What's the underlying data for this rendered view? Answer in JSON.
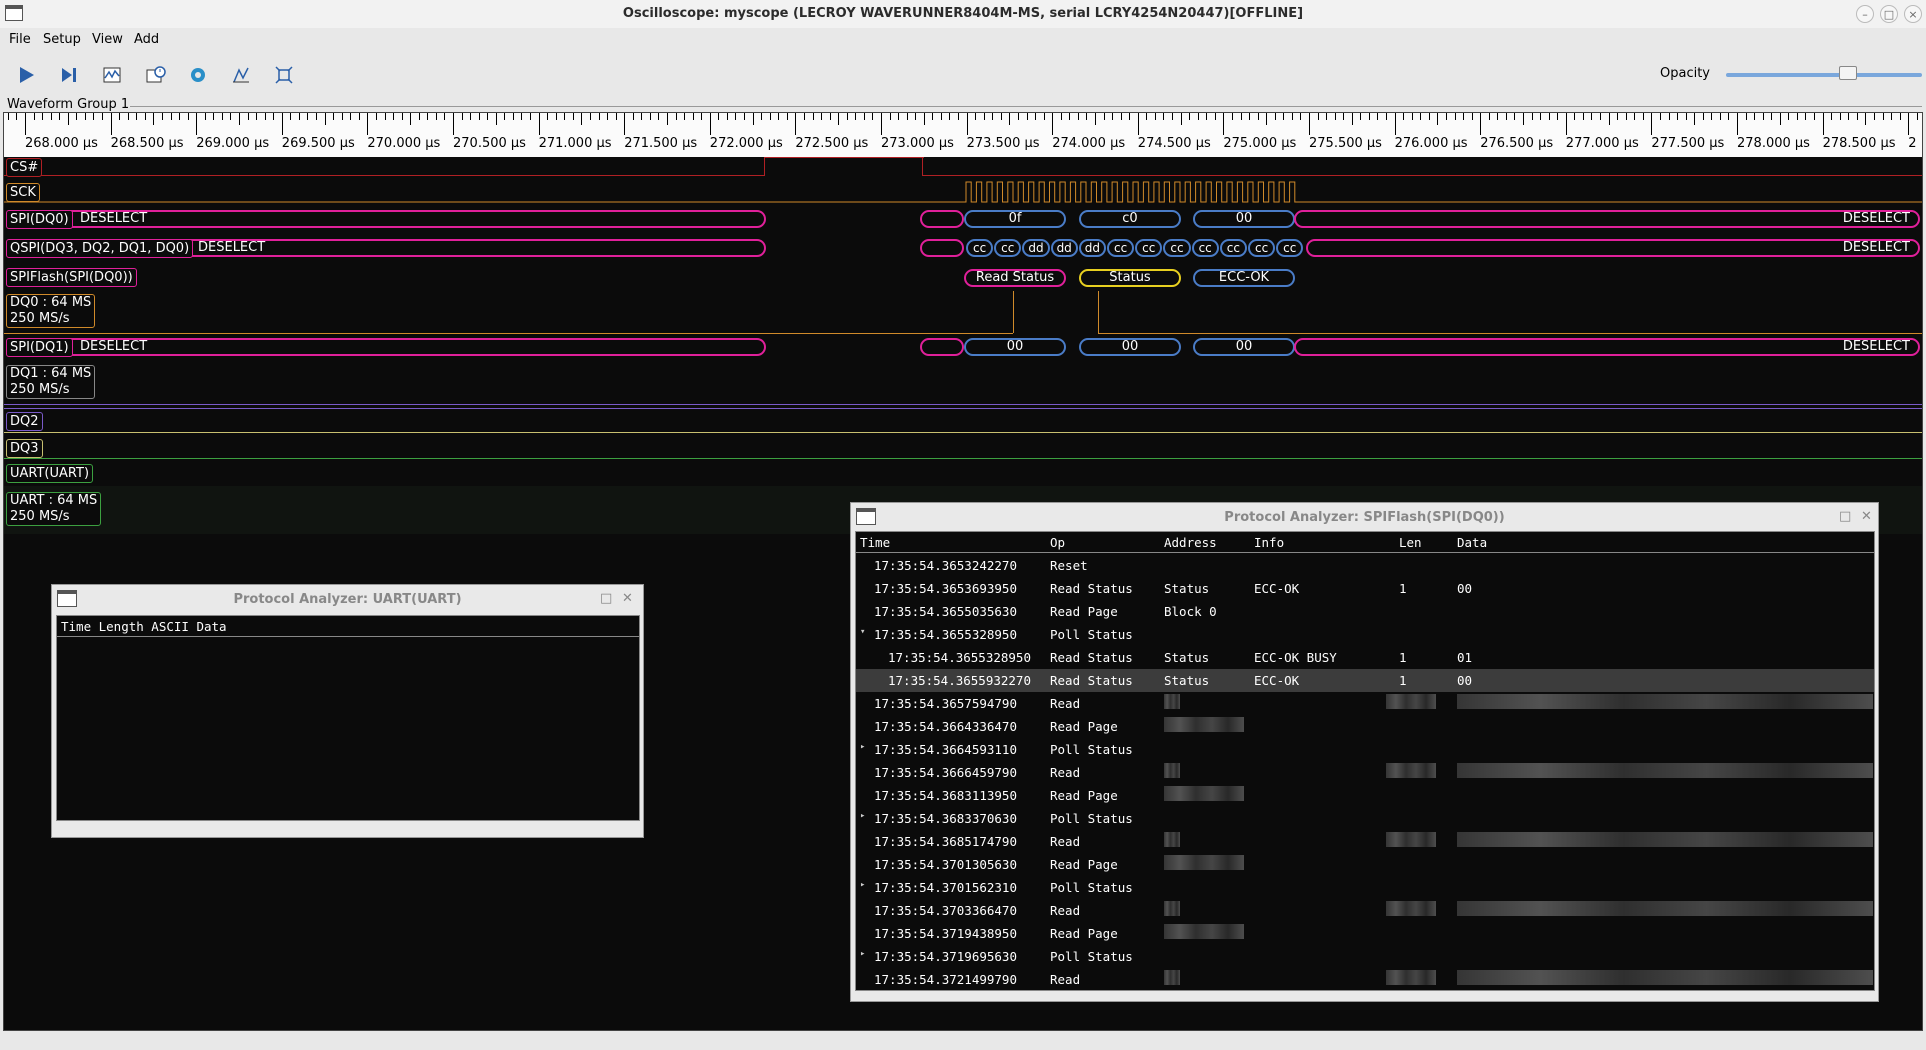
{
  "window": {
    "title": "Oscilloscope: myscope (LECROY WAVERUNNER8404M-MS, serial LCRY4254N20447)[OFFLINE]"
  },
  "menu": [
    "File",
    "Setup",
    "View",
    "Add"
  ],
  "toolbar": {
    "icons": [
      "start-icon",
      "single-trigger-icon",
      "waveform-icon",
      "history-icon",
      "gear-icon",
      "measure-icon",
      "fullscreen-icon"
    ],
    "opacity_label": "Opacity",
    "opacity_value": 0.62
  },
  "group": {
    "label": "Waveform Group 1"
  },
  "ruler": {
    "labels": [
      "268.000 µs",
      "268.500 µs",
      "269.000 µs",
      "269.500 µs",
      "270.000 µs",
      "270.500 µs",
      "271.000 µs",
      "271.500 µs",
      "272.000 µs",
      "272.500 µs",
      "273.000 µs",
      "273.500 µs",
      "274.000 µs",
      "274.500 µs",
      "275.000 µs",
      "275.500 µs",
      "276.000 µs",
      "276.500 µs",
      "277.000 µs",
      "277.500 µs",
      "278.000 µs",
      "278.500 µs",
      "2"
    ]
  },
  "traces": {
    "cs": "CS#",
    "sck": "SCK",
    "spi_dq0": {
      "name": "SPI(DQ0)",
      "left": "DESELECT",
      "right": "DESELECT",
      "bytes": [
        "0f",
        "c0",
        "00"
      ]
    },
    "qspi": {
      "name": "QSPI(DQ3, DQ2, DQ1, DQ0)",
      "left": "DESELECT",
      "right": "DESELECT",
      "nibbles": [
        "cc",
        "cc",
        "dd",
        "dd",
        "dd",
        "cc",
        "cc",
        "cc",
        "cc",
        "cc",
        "cc",
        "cc"
      ]
    },
    "spiflash": {
      "name": "SPIFlash(SPI(DQ0))",
      "ops": [
        "Read Status",
        "Status",
        "ECC-OK"
      ]
    },
    "dq0": {
      "name": "DQ0 : 64 MS",
      "rate": "250 MS/s"
    },
    "spi_dq1": {
      "name": "SPI(DQ1)",
      "left": "DESELECT",
      "right": "DESELECT",
      "bytes": [
        "00",
        "00",
        "00"
      ]
    },
    "dq1": {
      "name": "DQ1 : 64 MS",
      "rate": "250 MS/s"
    },
    "dq2": "DQ2",
    "dq3": "DQ3",
    "uart_dec": "UART(UART)",
    "uart": {
      "name": "UART : 64 MS",
      "rate": "250 MS/s"
    }
  },
  "uart_panel": {
    "title": "Protocol Analyzer: UART(UART)",
    "header": "Time Length ASCII Data"
  },
  "spi_panel": {
    "title": "Protocol Analyzer: SPIFlash(SPI(DQ0))",
    "columns": [
      "Time",
      "Op",
      "Address",
      "Info",
      "Len",
      "Data"
    ],
    "rows": [
      {
        "arrow": "",
        "time": "17:35:54.3653242270",
        "op": "Reset",
        "addr": "",
        "info": "",
        "len": "",
        "data": ""
      },
      {
        "arrow": "",
        "time": "17:35:54.3653693950",
        "op": "Read Status",
        "addr": "Status",
        "info": "ECC-OK",
        "len": "1",
        "data": "00"
      },
      {
        "arrow": "",
        "time": "17:35:54.3655035630",
        "op": "Read Page",
        "addr": "Block 0",
        "info": "",
        "len": "",
        "data": ""
      },
      {
        "arrow": "▾",
        "time": "17:35:54.3655328950",
        "op": "Poll Status",
        "addr": "",
        "info": "",
        "len": "",
        "data": ""
      },
      {
        "arrow": "",
        "indent": true,
        "time": "17:35:54.3655328950",
        "op": "Read Status",
        "addr": "Status",
        "info": "ECC-OK BUSY",
        "len": "1",
        "data": "01"
      },
      {
        "arrow": "",
        "indent": true,
        "sel": true,
        "time": "17:35:54.3655932270",
        "op": "Read Status",
        "addr": "Status",
        "info": "ECC-OK",
        "len": "1",
        "data": "00"
      },
      {
        "arrow": "",
        "time": "17:35:54.3657594790",
        "op": "Read",
        "addr": "",
        "info": "",
        "len": "",
        "data": "",
        "blurred": true
      },
      {
        "arrow": "",
        "time": "17:35:54.3664336470",
        "op": "Read Page",
        "addr": "",
        "info": "",
        "len": "",
        "data": "",
        "blurred_addr": true
      },
      {
        "arrow": "▸",
        "time": "17:35:54.3664593110",
        "op": "Poll Status",
        "addr": "",
        "info": "",
        "len": "",
        "data": ""
      },
      {
        "arrow": "",
        "time": "17:35:54.3666459790",
        "op": "Read",
        "addr": "",
        "info": "",
        "len": "",
        "data": "",
        "blurred": true
      },
      {
        "arrow": "",
        "time": "17:35:54.3683113950",
        "op": "Read Page",
        "addr": "",
        "info": "",
        "len": "",
        "data": "",
        "blurred_addr": true
      },
      {
        "arrow": "▸",
        "time": "17:35:54.3683370630",
        "op": "Poll Status",
        "addr": "",
        "info": "",
        "len": "",
        "data": ""
      },
      {
        "arrow": "",
        "time": "17:35:54.3685174790",
        "op": "Read",
        "addr": "",
        "info": "",
        "len": "",
        "data": "",
        "blurred": true
      },
      {
        "arrow": "",
        "time": "17:35:54.3701305630",
        "op": "Read Page",
        "addr": "",
        "info": "",
        "len": "",
        "data": "",
        "blurred_addr": true
      },
      {
        "arrow": "▸",
        "time": "17:35:54.3701562310",
        "op": "Poll Status",
        "addr": "",
        "info": "",
        "len": "",
        "data": ""
      },
      {
        "arrow": "",
        "time": "17:35:54.3703366470",
        "op": "Read",
        "addr": "",
        "info": "",
        "len": "",
        "data": "",
        "blurred": true
      },
      {
        "arrow": "",
        "time": "17:35:54.3719438950",
        "op": "Read Page",
        "addr": "",
        "info": "",
        "len": "",
        "data": "",
        "blurred_addr": true
      },
      {
        "arrow": "▸",
        "time": "17:35:54.3719695630",
        "op": "Poll Status",
        "addr": "",
        "info": "",
        "len": "",
        "data": ""
      },
      {
        "arrow": "",
        "time": "17:35:54.3721499790",
        "op": "Read",
        "addr": "",
        "info": "",
        "len": "",
        "data": "",
        "blurred": true
      }
    ]
  },
  "colors": {
    "magenta": "#e0209a",
    "orange": "#e0902a",
    "cs_red": "#c0282a",
    "blue": "#4a7cc7",
    "yellow": "#e8d020",
    "green": "#3ca040",
    "purple": "#7a5ac8"
  }
}
